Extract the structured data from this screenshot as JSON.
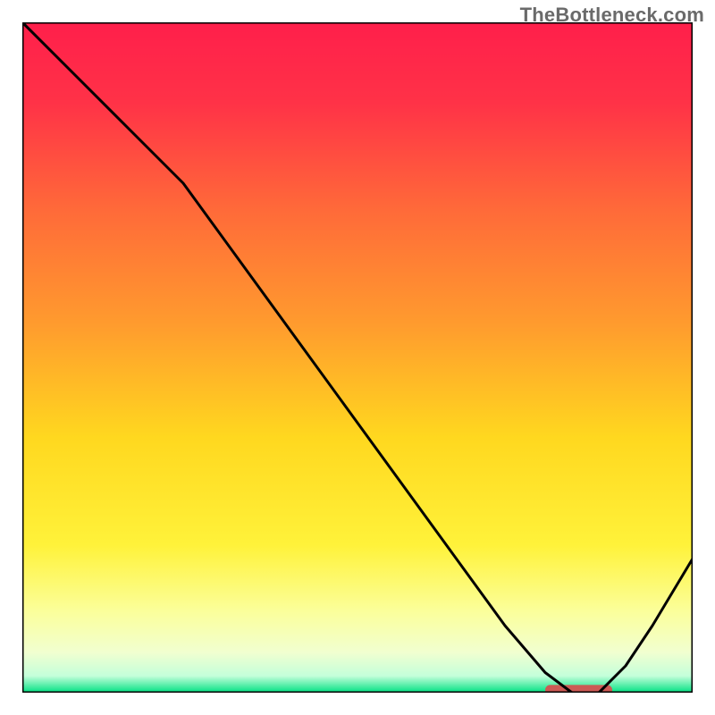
{
  "watermark": "TheBottleneck.com",
  "chart_data": {
    "type": "line",
    "title": "",
    "xlabel": "",
    "ylabel": "",
    "xlim": [
      0,
      100
    ],
    "ylim": [
      0,
      100
    ],
    "grid": false,
    "legend": false,
    "gradient_stops": [
      {
        "offset": 0.0,
        "color": "#ff1f4b"
      },
      {
        "offset": 0.12,
        "color": "#ff3247"
      },
      {
        "offset": 0.28,
        "color": "#ff6a39"
      },
      {
        "offset": 0.45,
        "color": "#ff9b2e"
      },
      {
        "offset": 0.62,
        "color": "#ffd81f"
      },
      {
        "offset": 0.78,
        "color": "#fff23a"
      },
      {
        "offset": 0.88,
        "color": "#fbff9c"
      },
      {
        "offset": 0.94,
        "color": "#f1ffd0"
      },
      {
        "offset": 0.975,
        "color": "#c4ffda"
      },
      {
        "offset": 1.0,
        "color": "#00e183"
      }
    ],
    "series": [
      {
        "name": "curve",
        "color": "#000000",
        "x": [
          0,
          8,
          16,
          24,
          32,
          40,
          48,
          56,
          64,
          72,
          78,
          82,
          86,
          90,
          94,
          100
        ],
        "y": [
          100,
          92,
          84,
          76,
          65,
          54,
          43,
          32,
          21,
          10,
          3,
          0,
          0,
          4,
          10,
          20
        ]
      }
    ],
    "marker": {
      "name": "range-marker",
      "x0": 78,
      "x1": 88,
      "y": 0.4,
      "thickness": 1.5,
      "color": "#cc5a55"
    }
  }
}
